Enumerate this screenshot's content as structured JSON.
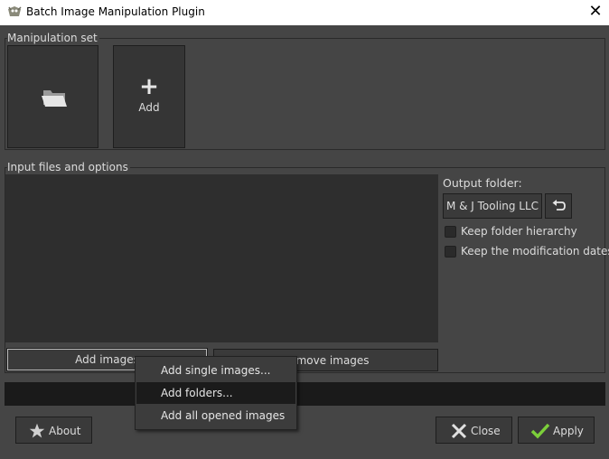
{
  "window": {
    "title": "Batch Image Manipulation Plugin",
    "close_glyph": "✕"
  },
  "manipulation": {
    "title": "Manipulation set",
    "add_label": "Add",
    "add_glyph": "+"
  },
  "input": {
    "title": "Input files and options",
    "add_images_label": "Add images",
    "remove_images_label": "Remove images",
    "output_folder_label": "Output folder:",
    "output_folder_value": "M & J Tooling LLC",
    "keep_hierarchy_label": "Keep folder hierarchy",
    "keep_dates_label": "Keep the modification dates",
    "keep_hierarchy_checked": false,
    "keep_dates_checked": false
  },
  "popup_menu": {
    "items": [
      {
        "label": "Add single images..."
      },
      {
        "label": "Add folders..."
      },
      {
        "label": "Add all opened images"
      }
    ],
    "highlighted_index": 1
  },
  "footer": {
    "about_label": "About",
    "close_label": "Close",
    "apply_label": "Apply"
  },
  "icons": {
    "app": "gimp-icon",
    "folder": "folder-icon",
    "plus": "plus-icon",
    "undo": "undo-icon",
    "star": "star-icon",
    "close": "x-icon",
    "apply": "checkmark-icon"
  },
  "colors": {
    "accent_check": "#7ccf3a",
    "close_x": "#e0e0e0",
    "background": "#454545"
  }
}
